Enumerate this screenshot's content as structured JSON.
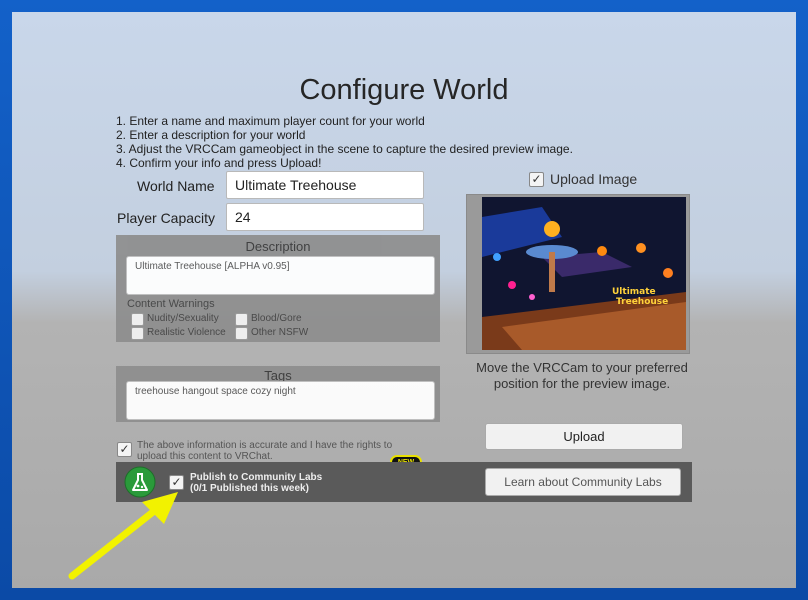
{
  "page": {
    "title": "Configure World"
  },
  "steps": [
    "1. Enter a name and maximum player count for your world",
    "2. Enter a description for your world",
    "3. Adjust the VRCCam gameobject in the scene to capture the desired preview image.",
    "4. Confirm your info and press Upload!"
  ],
  "form": {
    "world_name_label": "World Name",
    "world_name_value": "Ultimate Treehouse",
    "player_capacity_label": "Player Capacity",
    "player_capacity_value": "24"
  },
  "description": {
    "title": "Description",
    "value": "Ultimate Treehouse [ALPHA v0.95]",
    "content_warnings_label": "Content Warnings",
    "warnings": [
      "Nudity/Sexuality",
      "Blood/Gore",
      "Realistic Violence",
      "Other NSFW"
    ]
  },
  "tags": {
    "title": "Tags",
    "value": "treehouse hangout space cozy night"
  },
  "rights": {
    "checked": true,
    "text_line1": "The above information is accurate and I have the rights to",
    "text_line2": "upload this content to VRChat."
  },
  "community_labs": {
    "checked": true,
    "line1": "Publish to Community Labs",
    "line2": "(0/1 Published this week)",
    "new_badge": "NEW",
    "learn_button": "Learn about Community Labs"
  },
  "preview": {
    "upload_image_label": "Upload Image",
    "upload_image_checked": true,
    "logo_text_1": "Ultimate",
    "logo_text_2": "Treehouse",
    "caption_line1": "Move the VRCCam to your preferred",
    "caption_line2": "position for the preview image."
  },
  "upload_button": "Upload",
  "colors": {
    "arrow": "#f2f200",
    "labs_icon": "#2a9a3a",
    "frame": "#1361c9"
  },
  "icons": {
    "labs": "flask-icon",
    "arrow": "annotation-arrow"
  }
}
